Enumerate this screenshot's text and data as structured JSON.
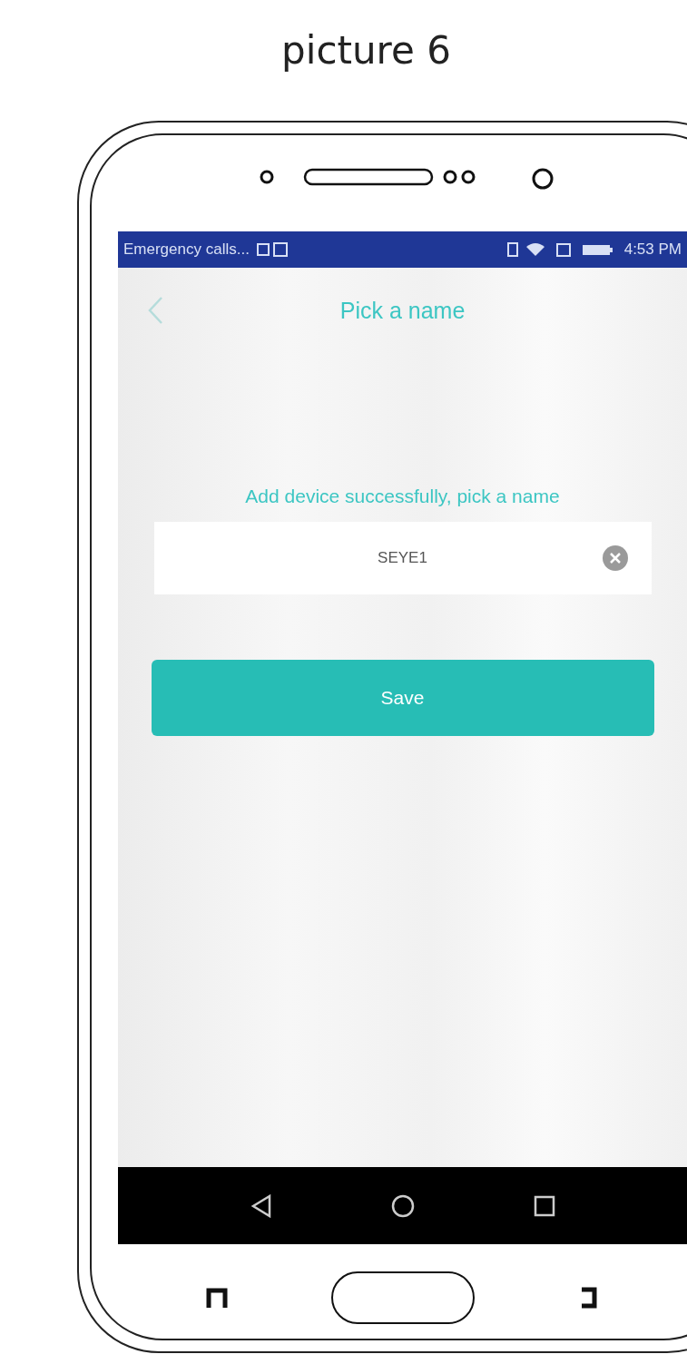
{
  "caption": "picture 6",
  "status_bar": {
    "carrier": "Emergency calls...",
    "time": "4:53 PM"
  },
  "app_bar": {
    "title": "Pick a name"
  },
  "prompt": "Add device successfully, pick a name",
  "name_field": {
    "value": "SEYE1"
  },
  "save_button": {
    "label": "Save"
  }
}
